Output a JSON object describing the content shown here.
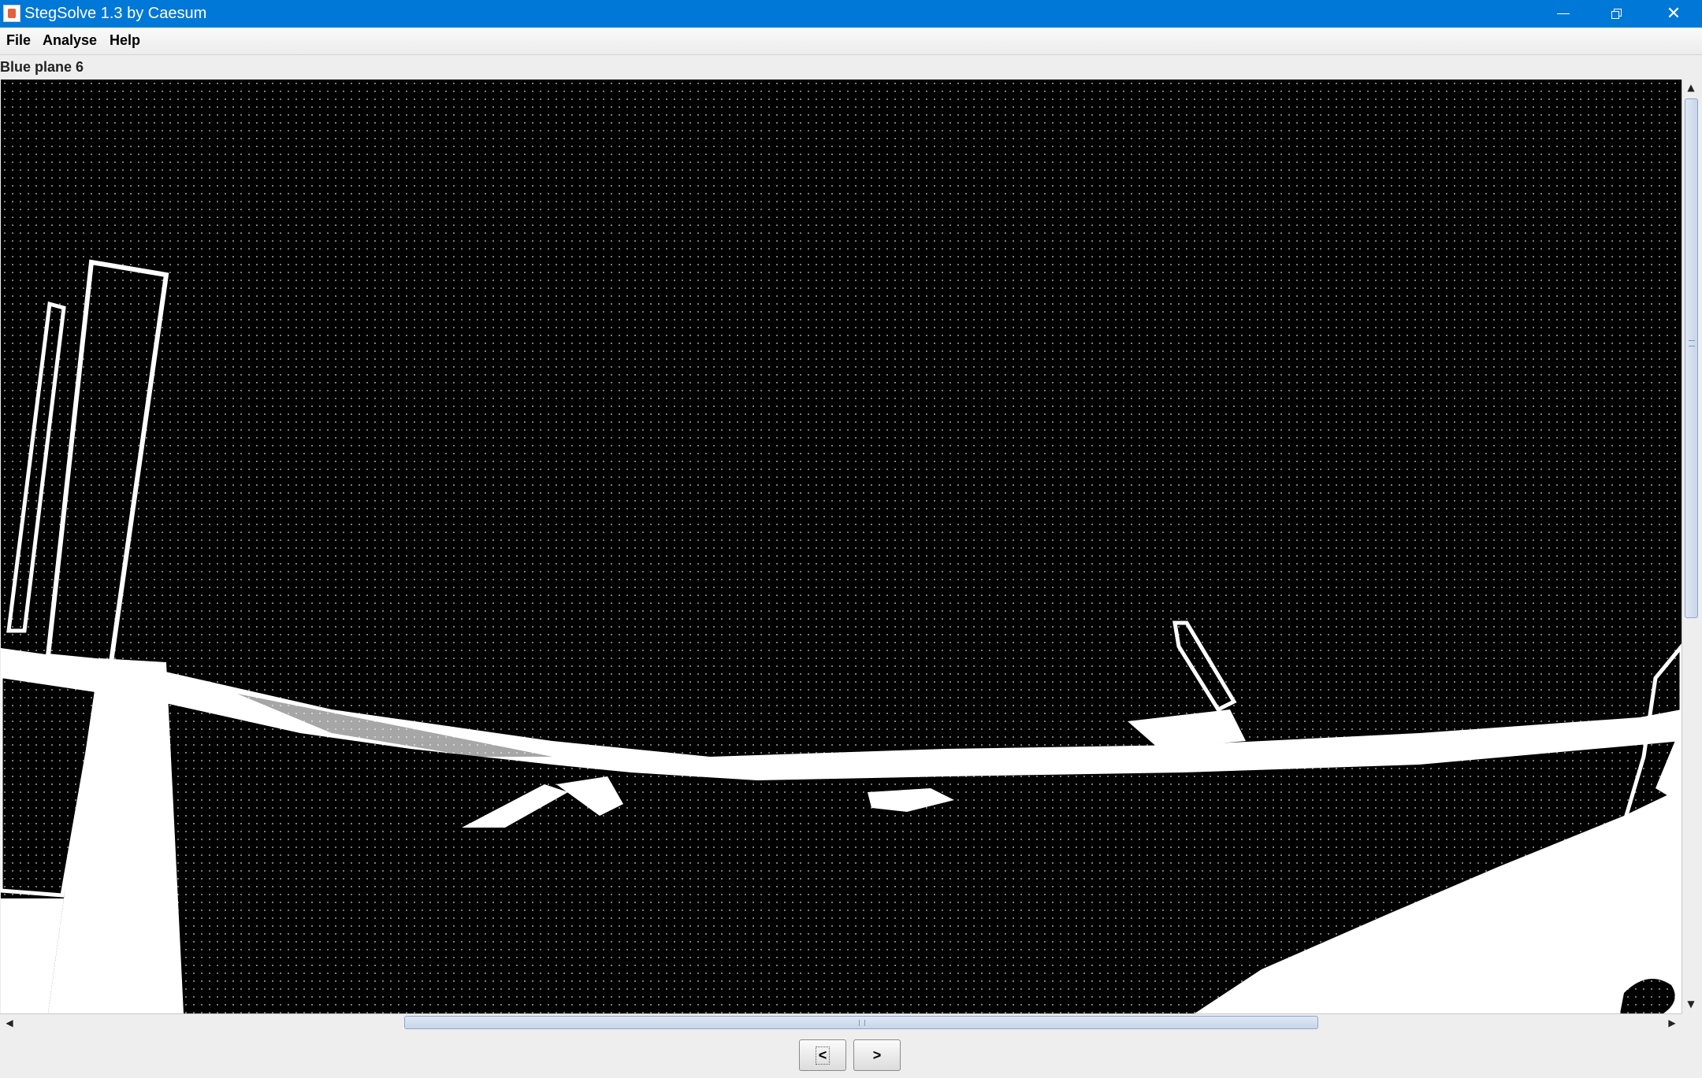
{
  "window": {
    "title": "StegSolve 1.3 by Caesum",
    "controls": [
      "minimize",
      "restore",
      "close"
    ]
  },
  "menu": {
    "items": [
      {
        "label": "File"
      },
      {
        "label": "Analyse"
      },
      {
        "label": "Help"
      }
    ]
  },
  "view": {
    "plane_label": "Blue plane 6"
  },
  "navigation": {
    "prev_label": "<",
    "next_label": ">"
  },
  "scroll": {
    "horizontal_position": 0.44,
    "vertical_position": 0.0
  }
}
